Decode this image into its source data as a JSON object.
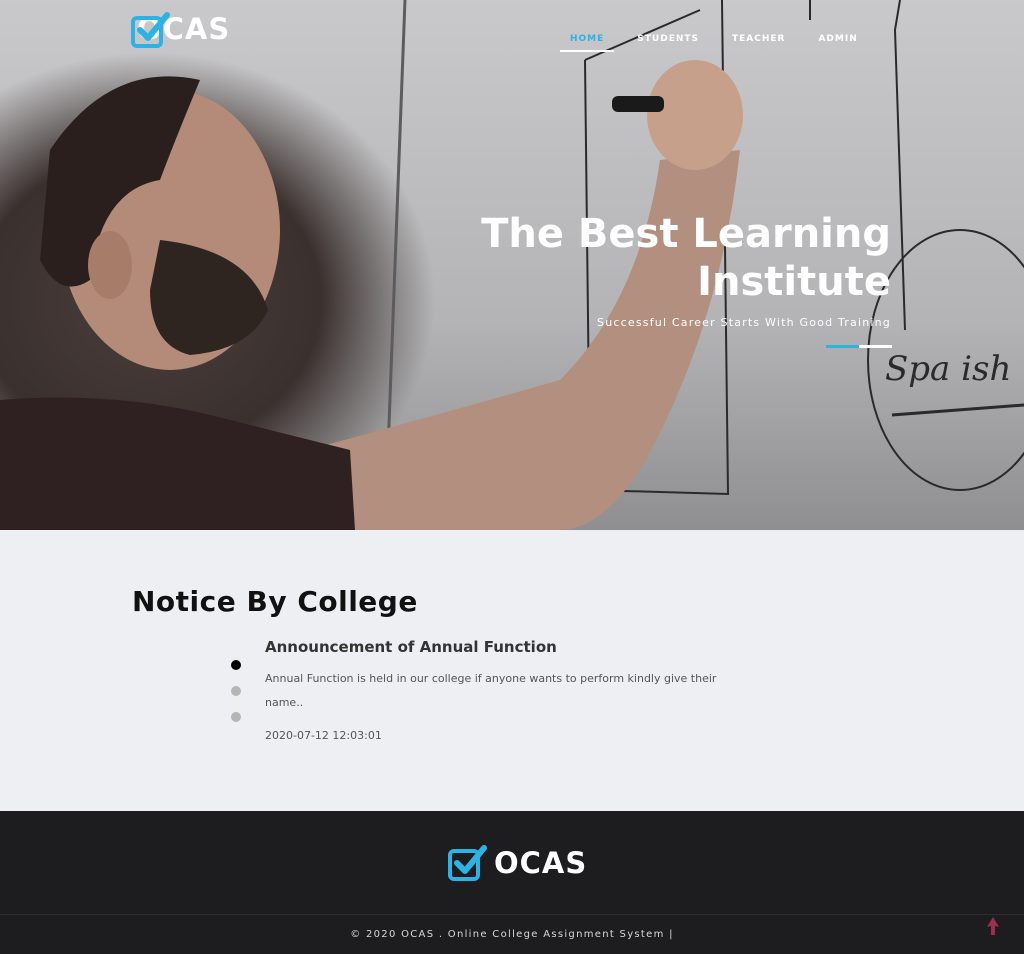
{
  "brand": {
    "name": "OCAS",
    "accent": "#2bb3e6"
  },
  "nav": {
    "items": [
      {
        "label": "HOME",
        "active": true
      },
      {
        "label": "STUDENTS",
        "active": false
      },
      {
        "label": "TEACHER",
        "active": false
      },
      {
        "label": "ADMIN",
        "active": false
      }
    ]
  },
  "hero": {
    "title": "The Best Learning Institute",
    "subtitle": "Successful Career Starts With Good Training",
    "board_text": "Spanish"
  },
  "notice": {
    "heading": "Notice By College",
    "slides_count": 3,
    "active_slide": 1,
    "item": {
      "title": "Announcement of Annual Function",
      "body": "Annual Function is held in our college if anyone wants to perform kindly give their name..",
      "date": "2020-07-12 12:03:01"
    }
  },
  "footer": {
    "copyright": "© 2020 OCAS . Online College Assignment System |",
    "back_to_top_icon": "arrow-up-icon",
    "arrow_color": "#9c2f4e"
  }
}
